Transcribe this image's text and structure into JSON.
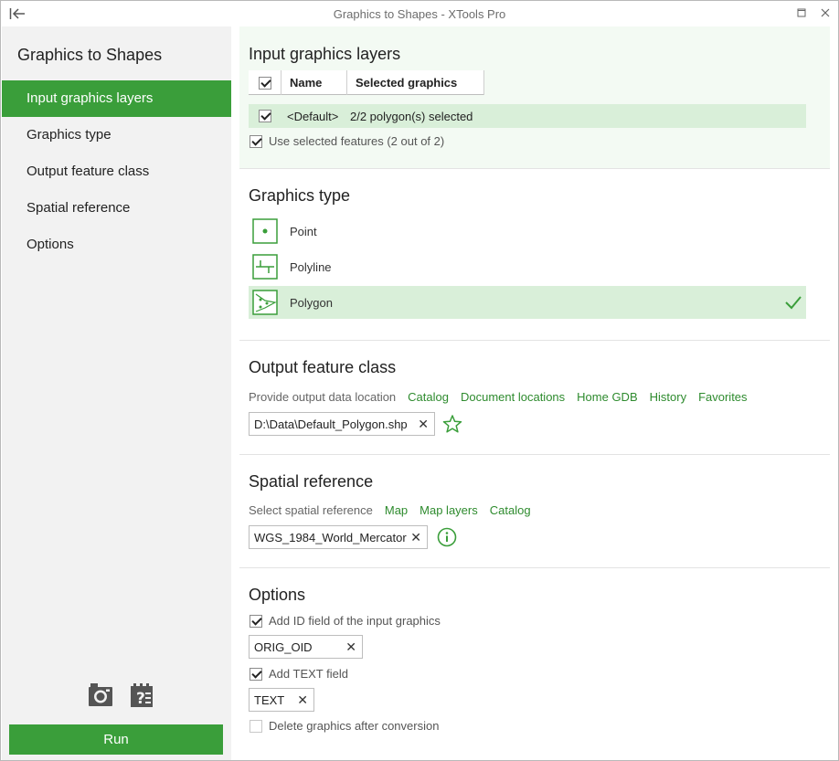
{
  "window": {
    "title": "Graphics to Shapes - XTools Pro"
  },
  "sidebar": {
    "title": "Graphics to Shapes",
    "items": [
      {
        "label": "Input graphics layers"
      },
      {
        "label": "Graphics type"
      },
      {
        "label": "Output feature class"
      },
      {
        "label": "Spatial reference"
      },
      {
        "label": "Options"
      }
    ],
    "tools": [
      "camera-icon",
      "notes-help-icon"
    ],
    "run_label": "Run"
  },
  "input": {
    "heading": "Input graphics layers",
    "columns": {
      "name": "Name",
      "selected": "Selected graphics"
    },
    "row": {
      "name": "<Default>",
      "selected": "2/2 polygon(s) selected",
      "checked": true
    },
    "use_selected": "Use selected features (2 out of 2)"
  },
  "graphics_type": {
    "heading": "Graphics type",
    "options": [
      {
        "label": "Point",
        "icon": "point-icon"
      },
      {
        "label": "Polyline",
        "icon": "polyline-icon"
      },
      {
        "label": "Polygon",
        "icon": "polygon-icon",
        "selected": true
      }
    ]
  },
  "output": {
    "heading": "Output feature class",
    "prompt": "Provide output data location",
    "links": [
      "Catalog",
      "Document locations",
      "Home GDB",
      "History",
      "Favorites"
    ],
    "path": "D:\\Data\\Default_Polygon.shp"
  },
  "spatial": {
    "heading": "Spatial reference",
    "prompt": "Select spatial reference",
    "links": [
      "Map",
      "Map layers",
      "Catalog"
    ],
    "value": "WGS_1984_World_Mercator"
  },
  "options": {
    "heading": "Options",
    "add_id_label": "Add ID field of the input graphics",
    "id_field": "ORIG_OID",
    "add_text_label": "Add TEXT field",
    "text_field": "TEXT",
    "delete_label": "Delete graphics after conversion"
  },
  "colors": {
    "accent": "#3a9e3a",
    "selected_row": "#d9efd9",
    "link": "#2e8b2e"
  }
}
